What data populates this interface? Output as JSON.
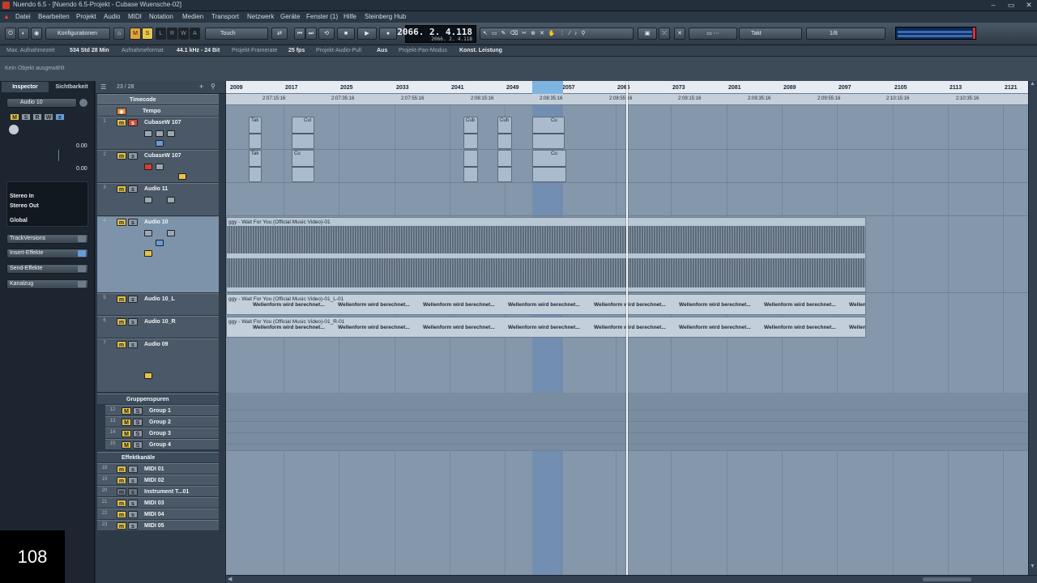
{
  "window": {
    "title": "Nuendo 6.5 - [Nuendo 6.5-Projekt - Cubase Wuensche-02]"
  },
  "menu": [
    "Datei",
    "Bearbeiten",
    "Projekt",
    "Audio",
    "MIDI",
    "Notation",
    "Medien",
    "Transport",
    "Netzwerk",
    "Geräte",
    "Fenster (1)",
    "Hilfe",
    "Steinberg Hub"
  ],
  "toolbar": {
    "config_label": "Konfigurationen",
    "automation_mode": "Touch",
    "time_main": "2066. 2. 4.118",
    "time_sub": "2066. 2. 4.118",
    "grid_type": "Takt",
    "quantize": "1/8",
    "m_label": "M",
    "s_label": "S",
    "l_label": "L",
    "r_label": "R",
    "w_label": "W",
    "a_label": "A"
  },
  "infobar": {
    "max_rec_label": "Max. Aufnahmezeit",
    "max_rec_value": "534 Std 28 Min",
    "format_label": "Aufnahmeformat",
    "format_value": "44.1 kHz - 24 Bit",
    "framerate_label": "Projekt-Framerate",
    "framerate_value": "25 fps",
    "pull_label": "Projekt-Audio-Pull",
    "pull_value": "Aus",
    "pan_label": "Projekt-Pan-Modus",
    "pan_value": "Konst. Leistung"
  },
  "status": {
    "text": "Kein Objekt ausgewählt"
  },
  "inspector": {
    "tab_inspector": "Inspector",
    "tab_visibility": "Sichtbarkeit",
    "track_name": "Audio 10",
    "vol1": "0.00",
    "vol2": "0.00",
    "input": "Stereo In",
    "output": "Stereo Out",
    "global": "Global",
    "sections": [
      "TrackVersions",
      "Insert-Effekte",
      "Send-Effekte",
      "Kanalzug"
    ]
  },
  "tracklist": {
    "count": "23 / 28"
  },
  "tracks": [
    {
      "num": "",
      "name": "Timecode"
    },
    {
      "num": "",
      "name": "Tempo"
    },
    {
      "num": "1",
      "name": "CubaseW 107"
    },
    {
      "num": "2",
      "name": "CubaseW 107"
    },
    {
      "num": "3",
      "name": "Audio 11"
    },
    {
      "num": "4",
      "name": "Audio 10"
    },
    {
      "num": "5",
      "name": "Audio 10_L"
    },
    {
      "num": "6",
      "name": "Audio 10_R"
    },
    {
      "num": "7",
      "name": "Audio 09"
    },
    {
      "num": "",
      "name": "Gruppenspuren"
    },
    {
      "num": "12",
      "name": "Group 1"
    },
    {
      "num": "13",
      "name": "Group 2"
    },
    {
      "num": "14",
      "name": "Group 3"
    },
    {
      "num": "15",
      "name": "Group 4"
    },
    {
      "num": "",
      "name": "Effektkanäle"
    },
    {
      "num": "18",
      "name": "MIDI 01"
    },
    {
      "num": "19",
      "name": "MIDI 02"
    },
    {
      "num": "20",
      "name": "Instrument T...01"
    },
    {
      "num": "21",
      "name": "MIDI 03"
    },
    {
      "num": "22",
      "name": "MIDI 04"
    },
    {
      "num": "23",
      "name": "MIDI 05"
    }
  ],
  "ruler": {
    "bars": [
      "2009",
      "2017",
      "2025",
      "2033",
      "2041",
      "2049",
      "2057",
      "2065",
      "2073",
      "2081",
      "2089",
      "2097",
      "2105",
      "2113",
      "2121"
    ],
    "timecodes": [
      "2:07:15:16",
      "2:07:35:16",
      "2:07:55:16",
      "2:08:15:16",
      "2:08:35:16",
      "2:08:55:16",
      "2:09:15:16",
      "2:09:35:16",
      "2:09:55:16",
      "2:10:15:16",
      "2:10:35:16"
    ]
  },
  "events": {
    "small_labels": [
      "Tak",
      "Cul",
      "Cul",
      "Cub",
      "Cu",
      "Tak",
      "Cu",
      "Cu"
    ],
    "audio10_label": "ggy - Wait For You (Official Music Video)-01",
    "audio10L_label": "ggy - Wait For You (Official Music Video)-01_L-01",
    "audio10R_label": "ggy - Wait For You (Official Music Video)-01_R-01",
    "waveform_calc": "Wellenform wird berechnet...",
    "waveform_short": "Wellen"
  },
  "overlay": {
    "counter": "108"
  }
}
